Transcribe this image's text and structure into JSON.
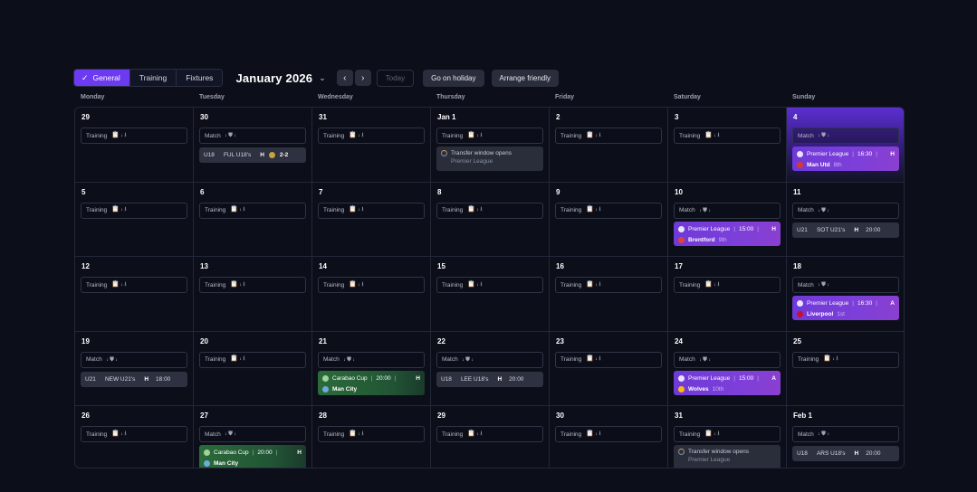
{
  "toolbar": {
    "tabs": [
      {
        "label": "General",
        "active": true
      },
      {
        "label": "Training",
        "active": false
      },
      {
        "label": "Fixtures",
        "active": false
      }
    ],
    "month_label": "January 2026",
    "today_label": "Today",
    "holiday_label": "Go on holiday",
    "friendly_label": "Arrange friendly"
  },
  "weekdays": [
    "Monday",
    "Tuesday",
    "Wednesday",
    "Thursday",
    "Friday",
    "Saturday",
    "Sunday"
  ],
  "icons": {
    "training": "📋 ⨾ ⭳",
    "match": "⨾ ⛊ ⨾"
  },
  "colors": {
    "accent": "#6c3af0",
    "premier_league": "#7b3fd9",
    "carabao_cup": "#2b6b3a"
  },
  "weeks": [
    [
      {
        "day": "29",
        "sched": "Training",
        "type": "training"
      },
      {
        "day": "30",
        "sched": "Match",
        "type": "match",
        "youth": {
          "age": "U18",
          "team": "FUL U18's",
          "ha": "H",
          "score": "2-2",
          "coin": true
        }
      },
      {
        "day": "31",
        "sched": "Training",
        "type": "training"
      },
      {
        "day": "Jan 1",
        "sched": "Training",
        "type": "training",
        "event": {
          "title": "Transfer window opens",
          "sub": "Premier League"
        }
      },
      {
        "day": "2",
        "sched": "Training",
        "type": "training"
      },
      {
        "day": "3",
        "sched": "Training",
        "type": "training"
      },
      {
        "day": "4",
        "sched": "Match",
        "type": "match",
        "today": true,
        "match": {
          "comp": "Premier League",
          "time": "16:30",
          "ha": "H",
          "opp": "Man Utd",
          "pos": "8th",
          "kind": "pl",
          "crest": "#d8392b"
        }
      }
    ],
    [
      {
        "day": "5",
        "sched": "Training",
        "type": "training"
      },
      {
        "day": "6",
        "sched": "Training",
        "type": "training"
      },
      {
        "day": "7",
        "sched": "Training",
        "type": "training"
      },
      {
        "day": "8",
        "sched": "Training",
        "type": "training"
      },
      {
        "day": "9",
        "sched": "Training",
        "type": "training"
      },
      {
        "day": "10",
        "sched": "Match",
        "type": "match",
        "match": {
          "comp": "Premier League",
          "time": "15:00",
          "ha": "H",
          "opp": "Brentford",
          "pos": "9th",
          "kind": "pl",
          "crest": "#e0423a"
        }
      },
      {
        "day": "11",
        "sched": "Match",
        "type": "match",
        "youth": {
          "age": "U21",
          "team": "SOT U21's",
          "ha": "H",
          "time": "20:00"
        }
      }
    ],
    [
      {
        "day": "12",
        "sched": "Training",
        "type": "training"
      },
      {
        "day": "13",
        "sched": "Training",
        "type": "training"
      },
      {
        "day": "14",
        "sched": "Training",
        "type": "training"
      },
      {
        "day": "15",
        "sched": "Training",
        "type": "training"
      },
      {
        "day": "16",
        "sched": "Training",
        "type": "training"
      },
      {
        "day": "17",
        "sched": "Training",
        "type": "training"
      },
      {
        "day": "18",
        "sched": "Match",
        "type": "match",
        "match": {
          "comp": "Premier League",
          "time": "16:30",
          "ha": "A",
          "opp": "Liverpool",
          "pos": "1st",
          "kind": "pl",
          "crest": "#c8102e"
        }
      }
    ],
    [
      {
        "day": "19",
        "sched": "Match",
        "type": "match",
        "youth": {
          "age": "U21",
          "team": "NEW U21's",
          "ha": "H",
          "time": "18:00"
        }
      },
      {
        "day": "20",
        "sched": "Training",
        "type": "training"
      },
      {
        "day": "21",
        "sched": "Match",
        "type": "match",
        "match": {
          "comp": "Carabao Cup",
          "time": "20:00",
          "ha": "H",
          "opp": "Man City",
          "pos": "",
          "kind": "cup",
          "crest": "#6cabdd"
        }
      },
      {
        "day": "22",
        "sched": "Match",
        "type": "match",
        "youth": {
          "age": "U18",
          "team": "LEE U18's",
          "ha": "H",
          "time": "20:00"
        }
      },
      {
        "day": "23",
        "sched": "Training",
        "type": "training"
      },
      {
        "day": "24",
        "sched": "Match",
        "type": "match",
        "match": {
          "comp": "Premier League",
          "time": "15:00",
          "ha": "A",
          "opp": "Wolves",
          "pos": "10th",
          "kind": "pl",
          "crest": "#fdb913"
        }
      },
      {
        "day": "25",
        "sched": "Training",
        "type": "training"
      }
    ],
    [
      {
        "day": "26",
        "sched": "Training",
        "type": "training"
      },
      {
        "day": "27",
        "sched": "Match",
        "type": "match",
        "match": {
          "comp": "Carabao Cup",
          "time": "20:00",
          "ha": "H",
          "opp": "Man City",
          "pos": "",
          "kind": "cup",
          "crest": "#6cabdd"
        }
      },
      {
        "day": "28",
        "sched": "Training",
        "type": "training"
      },
      {
        "day": "29",
        "sched": "Training",
        "type": "training"
      },
      {
        "day": "30",
        "sched": "Training",
        "type": "training"
      },
      {
        "day": "31",
        "sched": "Training",
        "type": "training",
        "event": {
          "title": "Transfer window opens",
          "sub": "Premier League"
        }
      },
      {
        "day": "Feb 1",
        "sched": "Match",
        "type": "match",
        "youth": {
          "age": "U18",
          "team": "ARS U18's",
          "ha": "H",
          "time": "20:00"
        }
      }
    ]
  ]
}
